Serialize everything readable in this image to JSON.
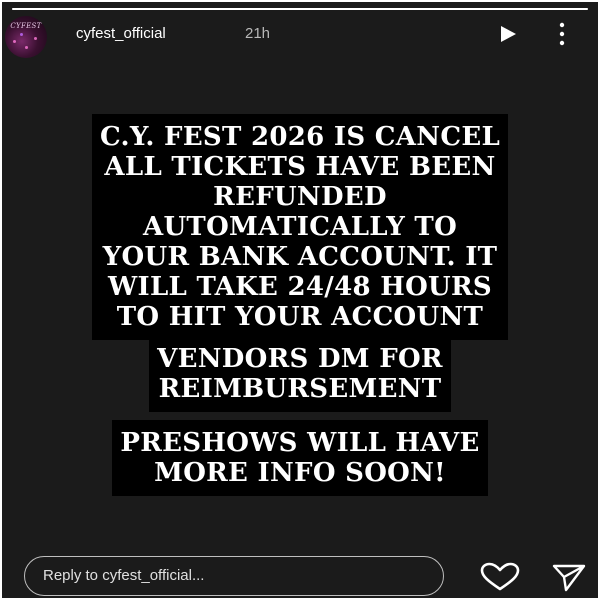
{
  "story": {
    "progress_fraction": 1.0,
    "account": {
      "avatar_text": "CYFEST",
      "username": "cyfest_official",
      "time_ago": "21h"
    },
    "icons": {
      "play": "play-icon",
      "more": "more-vertical-icon",
      "like": "heart-icon",
      "share": "send-icon"
    },
    "text_blocks": [
      {
        "lines": [
          "C.Y. FEST 2026 IS CANCEL",
          "ALL TICKETS HAVE BEEN",
          "REFUNDED",
          "AUTOMATICALLY TO",
          "YOUR BANK ACCOUNT. IT",
          "WILL TAKE 24/48 HOURS",
          "TO HIT YOUR ACCOUNT"
        ]
      },
      {
        "lines": [
          "VENDORS DM FOR",
          "REIMBURSEMENT"
        ]
      },
      {
        "lines": [
          "PRESHOWS WILL HAVE",
          "MORE INFO SOON!"
        ]
      }
    ],
    "reply": {
      "placeholder": "Reply to cyfest_official..."
    }
  },
  "colors": {
    "background": "#1b1b1b",
    "text_highlight": "#000000",
    "text": "#ffffff",
    "muted": "#b8b8b8"
  }
}
